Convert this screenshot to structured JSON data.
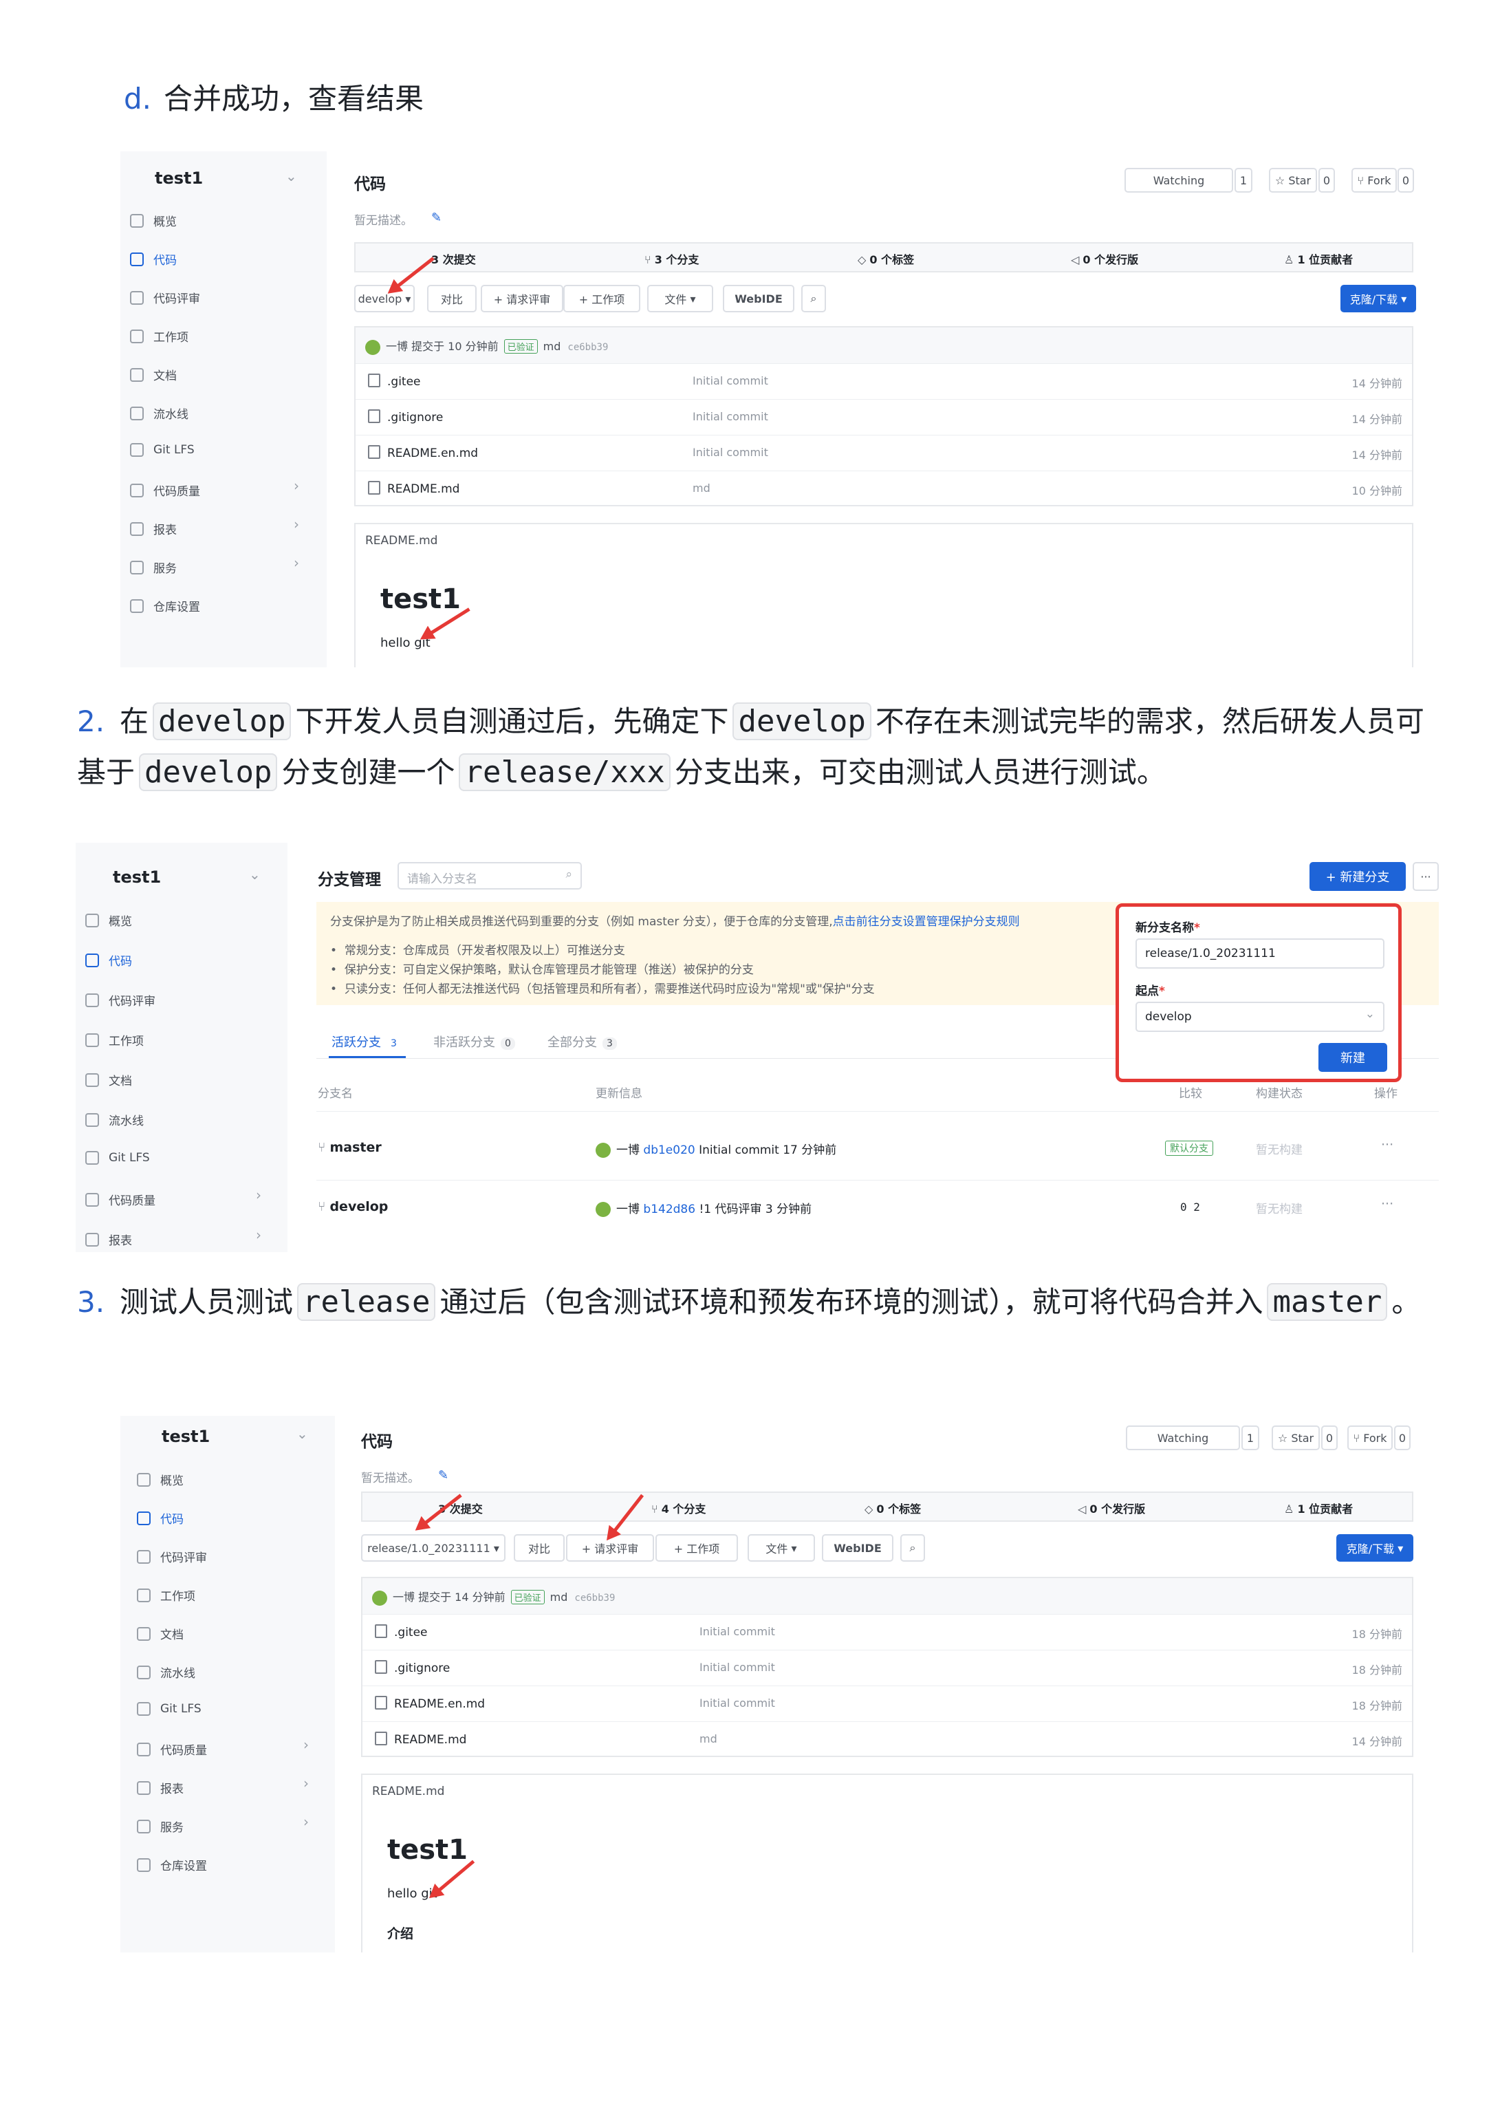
{
  "doc": {
    "heading_d": {
      "marker": "d.",
      "text": "合并成功，查看结果"
    },
    "step2": {
      "num": "2.",
      "t1": "在",
      "c1": "develop",
      "t2": "下开发人员自测通过后，先确定下",
      "c2": "develop",
      "t3": "不存在未测试完毕的需求，然后研发人员可基于",
      "c3": "develop",
      "t4": "分支创建一个",
      "c4": "release/xxx",
      "t5": "分支出来，可交由测试人员进行测试。"
    },
    "step3": {
      "num": "3.",
      "t1": "测试人员测试",
      "c1": "release",
      "t2": "通过后（包含测试环境和预发布环境的测试），就可将代码合并入",
      "c2": "master",
      "t3": "。"
    }
  },
  "shot1": {
    "repo": "test1",
    "nav": [
      "概览",
      "代码",
      "代码评审",
      "工作项",
      "文档",
      "流水线",
      "Git LFS",
      "代码质量",
      "报表",
      "服务",
      "仓库设置"
    ],
    "title": "代码",
    "desc": "暂无描述。",
    "watching": "Watching",
    "watch_count": "1",
    "star": "Star",
    "star_count": "0",
    "fork": "Fork",
    "fork_count": "0",
    "stats": [
      "3 次提交",
      "3 个分支",
      "0 个标签",
      "0 个发行版",
      "1 位贡献者"
    ],
    "branch": "develop",
    "buttons": [
      "对比",
      "+ 请求评审",
      "+ 工作项",
      "文件",
      "WebIDE"
    ],
    "clone": "克隆/下载",
    "commit": {
      "author": "一博 提交于 10 分钟前",
      "verified": "已验证",
      "msg": "md",
      "hash": "ce6bb39"
    },
    "files": [
      {
        "name": ".gitee",
        "msg": "Initial commit",
        "time": "14 分钟前"
      },
      {
        "name": ".gitignore",
        "msg": "Initial commit",
        "time": "14 分钟前"
      },
      {
        "name": "README.en.md",
        "msg": "Initial commit",
        "time": "14 分钟前"
      },
      {
        "name": "README.md",
        "msg": "md",
        "time": "10 分钟前"
      }
    ],
    "readme_title": "README.md",
    "readme_h1": "test1",
    "readme_p": "hello git"
  },
  "shot2": {
    "repo": "test1",
    "nav": [
      "概览",
      "代码",
      "代码评审",
      "工作项",
      "文档",
      "流水线",
      "Git LFS",
      "代码质量",
      "报表"
    ],
    "title": "分支管理",
    "search_placeholder": "请输入分支名",
    "new_branch": "+ 新建分支",
    "more": "···",
    "notice_line1": "分支保护是为了防止相关成员推送代码到重要的分支（例如 master 分支），便于仓库的分支管理,",
    "notice_link": "点击前往分支设置管理保护分支规则",
    "notice_items": [
      "常规分支：仓库成员（开发者权限及以上）可推送分支",
      "保护分支：可自定义保护策略，默认仓库管理员才能管理（推送）被保护的分支",
      "只读分支：任何人都无法推送代码（包括管理员和所有者），需要推送代码时应设为\"常规\"或\"保护\"分支"
    ],
    "tabs": [
      {
        "label": "活跃分支",
        "count": "3"
      },
      {
        "label": "非活跃分支",
        "count": "0"
      },
      {
        "label": "全部分支",
        "count": "3"
      }
    ],
    "headers": [
      "分支名",
      "更新信息",
      "比较",
      "构建状态",
      "操作"
    ],
    "rows": [
      {
        "name": "master",
        "info_author": "一博",
        "info_hash": "db1e020",
        "info_msg": "Initial commit  17 分钟前",
        "compare": "默认分支",
        "build": "暂无构建",
        "op": "···"
      },
      {
        "name": "develop",
        "info_author": "一博",
        "info_hash": "b142d86",
        "info_msg": "!1 代码评审  3 分钟前",
        "compare": "0  2",
        "build": "暂无构建",
        "op": "···"
      }
    ],
    "popup": {
      "name_label": "新分支名称",
      "name_value": "release/1.0_20231111",
      "from_label": "起点",
      "from_value": "develop",
      "submit": "新建"
    }
  },
  "shot3": {
    "repo": "test1",
    "nav": [
      "概览",
      "代码",
      "代码评审",
      "工作项",
      "文档",
      "流水线",
      "Git LFS",
      "代码质量",
      "报表",
      "服务",
      "仓库设置"
    ],
    "title": "代码",
    "desc": "暂无描述。",
    "watching": "Watching",
    "watch_count": "1",
    "star": "Star",
    "star_count": "0",
    "fork": "Fork",
    "fork_count": "0",
    "stats": [
      "3 次提交",
      "4 个分支",
      "0 个标签",
      "0 个发行版",
      "1 位贡献者"
    ],
    "branch": "release/1.0_20231111",
    "buttons": [
      "对比",
      "+ 请求评审",
      "+ 工作项",
      "文件",
      "WebIDE"
    ],
    "clone": "克隆/下载",
    "commit": {
      "author": "一博 提交于 14 分钟前",
      "verified": "已验证",
      "msg": "md",
      "hash": "ce6bb39"
    },
    "files": [
      {
        "name": ".gitee",
        "msg": "Initial commit",
        "time": "18 分钟前"
      },
      {
        "name": ".gitignore",
        "msg": "Initial commit",
        "time": "18 分钟前"
      },
      {
        "name": "README.en.md",
        "msg": "Initial commit",
        "time": "18 分钟前"
      },
      {
        "name": "README.md",
        "msg": "md",
        "time": "14 分钟前"
      }
    ],
    "readme_title": "README.md",
    "readme_h1": "test1",
    "readme_p": "hello git",
    "readme_h2": "介绍"
  }
}
